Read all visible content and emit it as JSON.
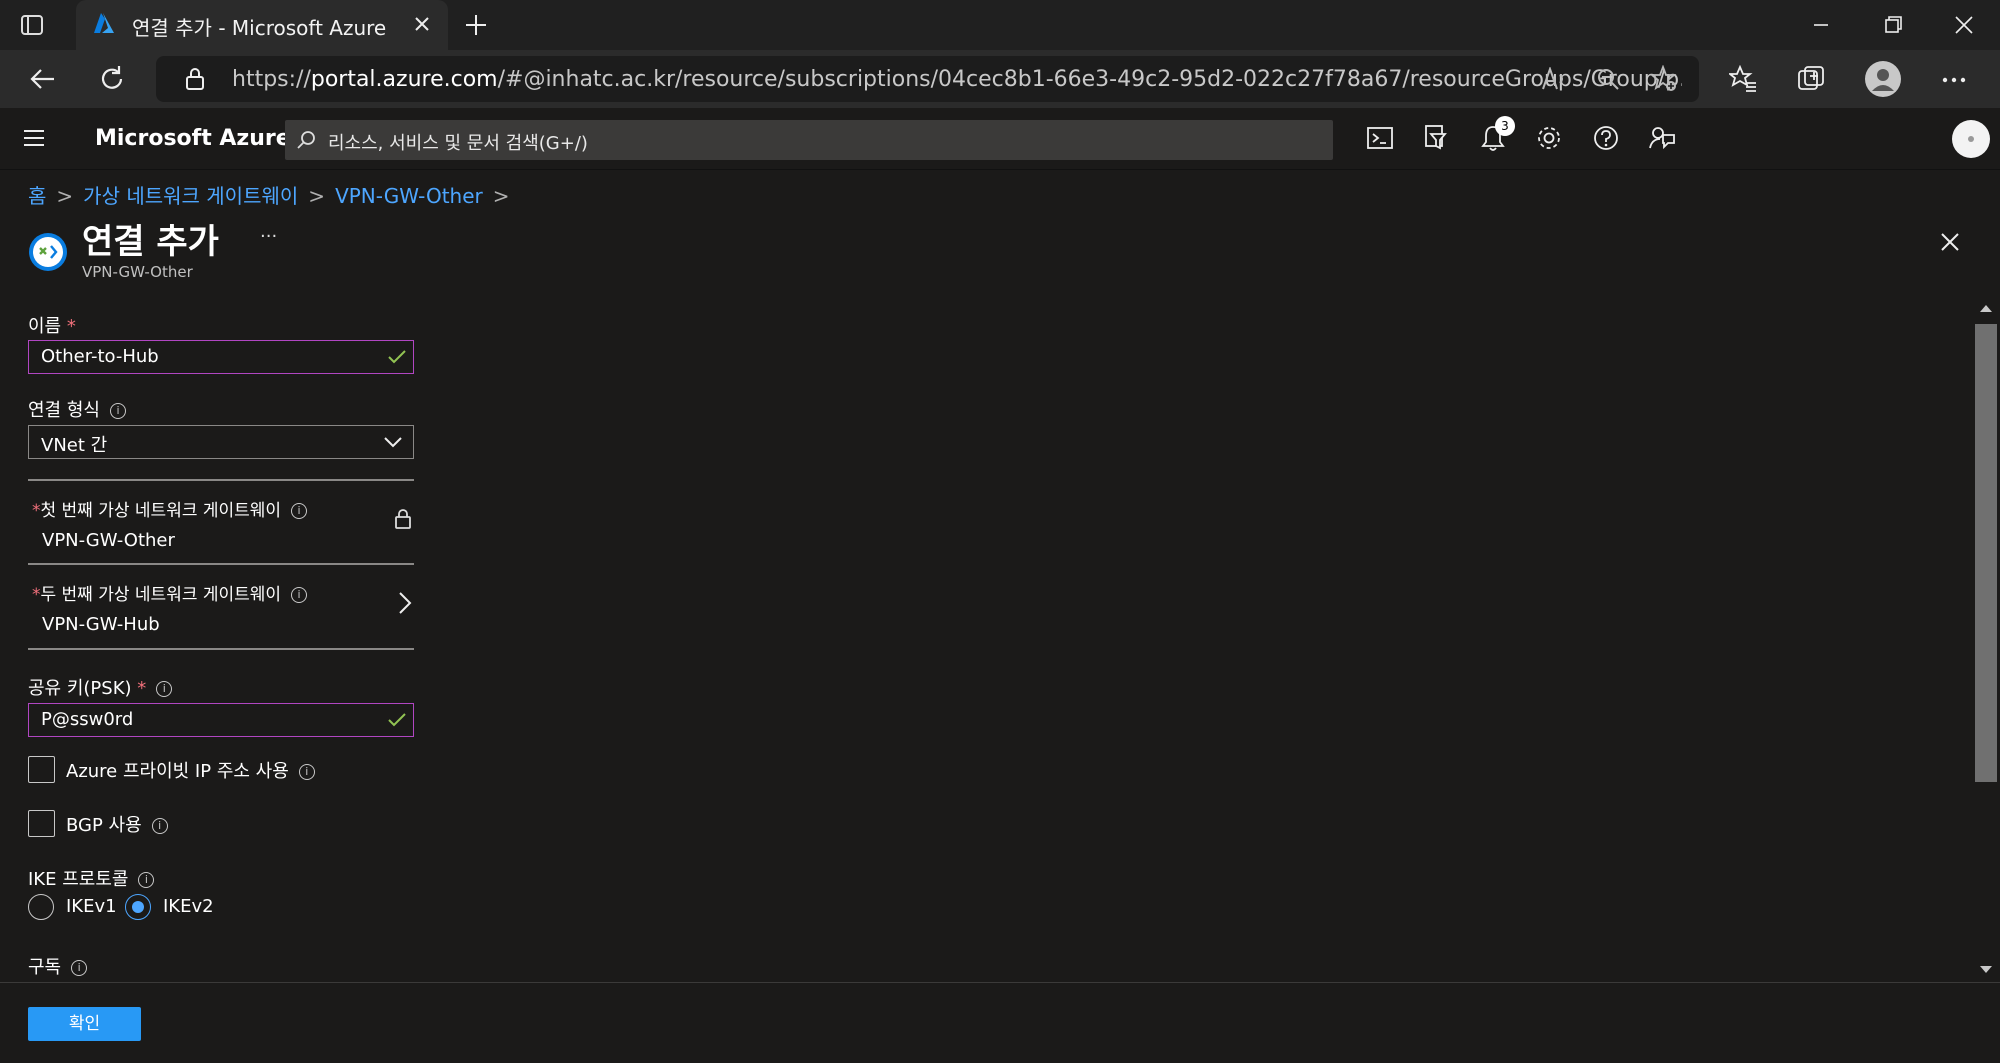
{
  "browser": {
    "tab_title": "연결 추가 - Microsoft Azure",
    "url_prefix": "https://",
    "url_host": "portal.azure.com",
    "url_rest": "/#@inhatc.ac.kr/resource/subscriptions/04cec8b1-66e3-49c2-95d2-022c27f78a67/resourceGroups/Group/p..."
  },
  "header": {
    "brand": "Microsoft Azure",
    "search_placeholder": "리소스, 서비스 및 문서 검색(G+/)",
    "notification_count": "3"
  },
  "breadcrumb": [
    "홈",
    "가상 네트워크 게이트웨이",
    "VPN-GW-Other"
  ],
  "blade": {
    "title": "연결 추가",
    "subtitle": "VPN-GW-Other",
    "more": "···"
  },
  "form": {
    "name_label": "이름",
    "name_value": "Other-to-Hub",
    "conn_type_label": "연결 형식",
    "conn_type_value": "VNet 간",
    "first_gw_label": "첫 번째 가상 네트워크 게이트웨이",
    "first_gw_value": "VPN-GW-Other",
    "second_gw_label": "두 번째 가상 네트워크 게이트웨이",
    "second_gw_value": "VPN-GW-Hub",
    "psk_label": "공유 키(PSK)",
    "psk_value": "P@ssw0rd",
    "private_ip_label": "Azure 프라이빗 IP 주소 사용",
    "bgp_label": "BGP 사용",
    "ike_label": "IKE 프로토콜",
    "ike_options": [
      "IKEv1",
      "IKEv2"
    ],
    "ike_selected": "IKEv2",
    "subscription_label": "구독",
    "required_mark": "*",
    "info_glyph": "i"
  },
  "footer": {
    "ok_label": "확인"
  },
  "colors": {
    "accent": "#2899f5",
    "link": "#4da6ff",
    "focus_border": "#b146c2",
    "valid_check": "#92c353",
    "required": "#f1707b"
  }
}
